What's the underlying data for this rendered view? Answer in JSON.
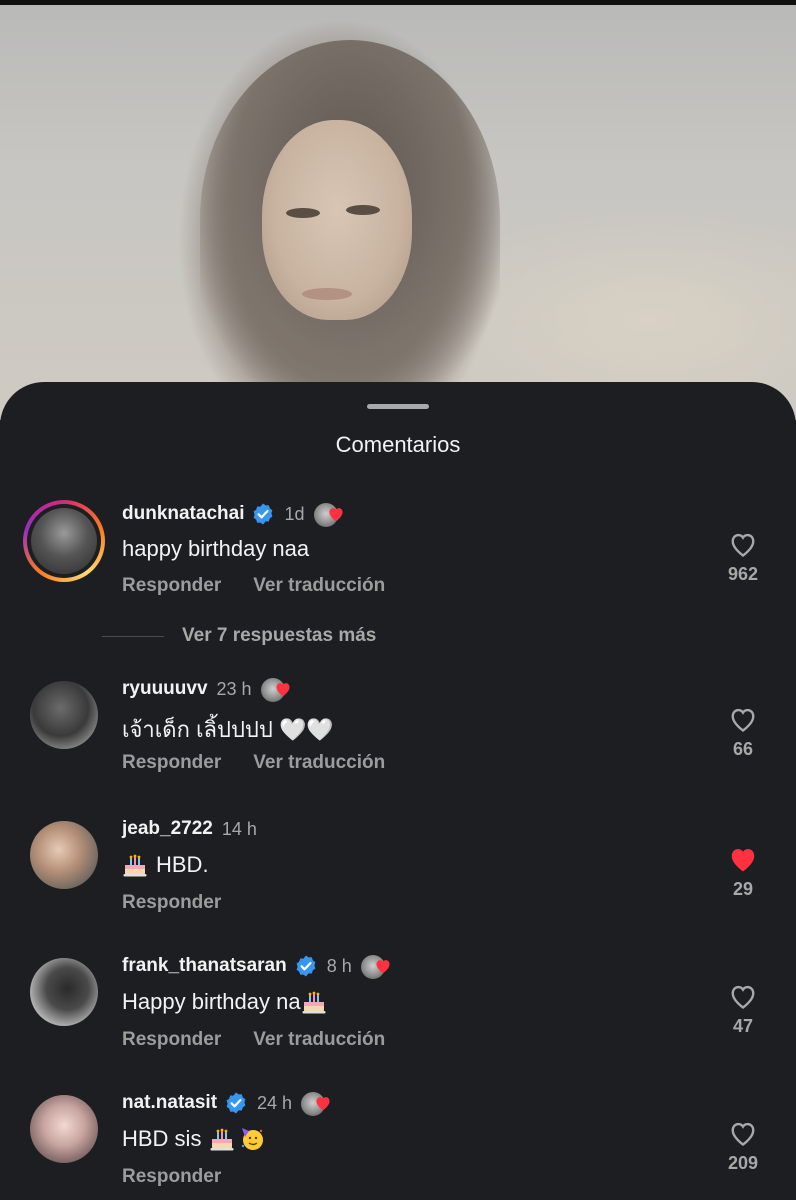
{
  "sheet": {
    "title": "Comentarios"
  },
  "comments": [
    {
      "username": "dunknatachai",
      "verified": true,
      "time": "1d",
      "text": "happy birthday naa",
      "actions": [
        "Responder",
        "Ver traducción"
      ],
      "likes": "962",
      "liked": false,
      "liked_by_author": true,
      "story_ring": true,
      "more_replies": "Ver 7 respuestas más"
    },
    {
      "username": "ryuuuuvv",
      "verified": false,
      "time": "23 h",
      "text": "เจ้าเด็ก เลิ้ปปปป 🤍🤍",
      "actions": [
        "Responder",
        "Ver traducción"
      ],
      "likes": "66",
      "liked": false,
      "liked_by_author": true
    },
    {
      "username": "jeab_2722",
      "verified": false,
      "time": "14 h",
      "text": "HBD.",
      "text_prefix_emoji": "birthday-cake",
      "actions": [
        "Responder"
      ],
      "likes": "29",
      "liked": true,
      "liked_by_author": false
    },
    {
      "username": "frank_thanatsaran",
      "verified": true,
      "time": "8 h",
      "text": "Happy birthday na",
      "text_suffix_emoji": "birthday-cake",
      "actions": [
        "Responder",
        "Ver traducción"
      ],
      "likes": "47",
      "liked": false,
      "liked_by_author": true
    },
    {
      "username": "nat.natasit",
      "verified": true,
      "time": "24 h",
      "text": "HBD sis",
      "text_suffix_emoji": "birthday-cake partying-face",
      "actions": [
        "Responder"
      ],
      "likes": "209",
      "liked": false,
      "liked_by_author": true
    }
  ],
  "colors": {
    "background": "#1c1e22",
    "text": "#f2f2f2",
    "muted": "#a8a8a8",
    "verified": "#3797f0",
    "like_active": "#ff3040"
  }
}
